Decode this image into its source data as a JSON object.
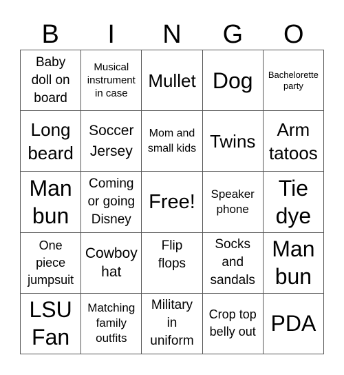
{
  "header": {
    "letters": [
      "B",
      "I",
      "N",
      "G",
      "O"
    ]
  },
  "cells": [
    [
      "Baby doll on board",
      "Musical instrument in case",
      "Mullet",
      "Dog",
      "Bachelorette party"
    ],
    [
      "Long beard",
      "Soccer Jersey",
      "Mom and small kids",
      "Twins",
      "Arm tatoos"
    ],
    [
      "Man bun",
      "Coming or going Disney",
      "Free!",
      "Speaker phone",
      "Tie dye"
    ],
    [
      "One piece jumpsuit",
      "Cowboy hat",
      "Flip flops",
      "Socks and sandals",
      "Man bun"
    ],
    [
      "LSU Fan",
      "Matching family outfits",
      "Military in uniform",
      "Crop top belly out",
      "PDA"
    ]
  ]
}
